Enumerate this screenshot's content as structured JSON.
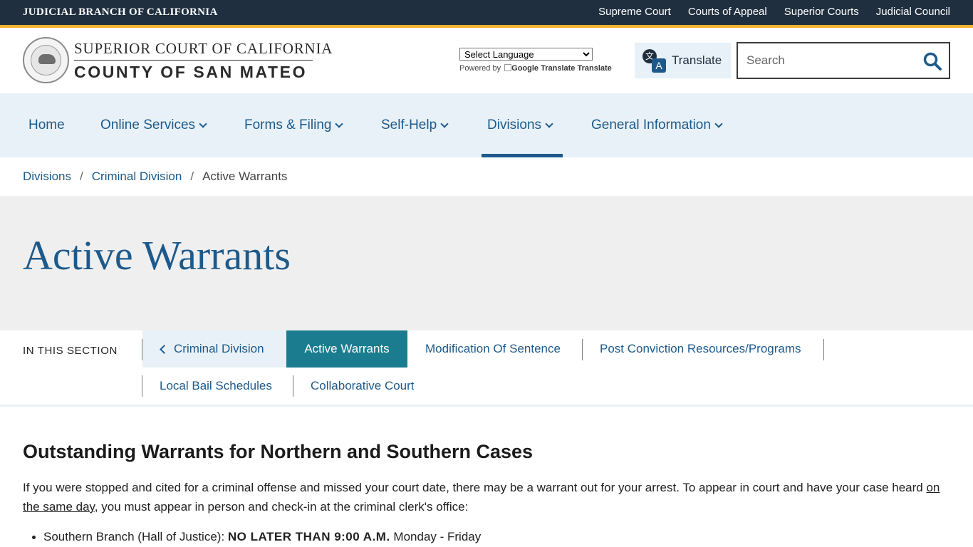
{
  "topbar": {
    "title": "JUDICIAL BRANCH OF CALIFORNIA",
    "links": [
      "Supreme Court",
      "Courts of Appeal",
      "Superior Courts",
      "Judicial Council"
    ]
  },
  "colors": {
    "topbar_bg": "#1f2f3f",
    "accent_gold": "#f2b12c",
    "brand_blue": "#1d5a8b",
    "nav_bg": "#e8f1f8",
    "active_tab": "#1b7c8f",
    "hero_bg": "#efefef"
  },
  "header": {
    "logo_line1": "SUPERIOR COURT OF CALIFORNIA",
    "logo_line2": "COUNTY OF SAN MATEO",
    "language_select": "Select Language",
    "powered_by": "Powered by",
    "google_translate": "Google Translate",
    "translate_word": "Translate",
    "translate_button": "Translate",
    "translate_icon": "translate-icon",
    "search_placeholder": "Search",
    "search_icon": "search-icon"
  },
  "nav": {
    "items": [
      {
        "label": "Home",
        "has_dropdown": false
      },
      {
        "label": "Online Services",
        "has_dropdown": true
      },
      {
        "label": "Forms & Filing",
        "has_dropdown": true
      },
      {
        "label": "Self-Help",
        "has_dropdown": true
      },
      {
        "label": "Divisions",
        "has_dropdown": true,
        "active": true
      },
      {
        "label": "General Information",
        "has_dropdown": true
      }
    ]
  },
  "breadcrumb": {
    "items": [
      "Divisions",
      "Criminal Division"
    ],
    "current": "Active Warrants",
    "separator": "/"
  },
  "page": {
    "title": "Active Warrants"
  },
  "in_this_section": {
    "label": "IN THIS SECTION",
    "back": "Criminal Division",
    "items": [
      {
        "label": "Active Warrants",
        "active": true
      },
      {
        "label": "Modification Of Sentence"
      },
      {
        "label": "Post Conviction Resources/Programs"
      },
      {
        "label": "Local Bail Schedules"
      },
      {
        "label": "Collaborative Court"
      }
    ]
  },
  "content": {
    "heading": "Outstanding Warrants for Northern and Southern Cases",
    "paragraph_start": "If you were stopped and cited for a criminal offense and missed your court date, there may be a warrant out for your arrest. To appear in court and have your case heard ",
    "paragraph_underlined": "on the same day",
    "paragraph_end": ", you must appear in person and check-in at the criminal clerk's office:",
    "list": [
      {
        "prefix": "Southern Branch (Hall of Justice): ",
        "bold": "NO LATER THAN 9:00 A.M.",
        "suffix": " Monday - Friday"
      }
    ]
  }
}
